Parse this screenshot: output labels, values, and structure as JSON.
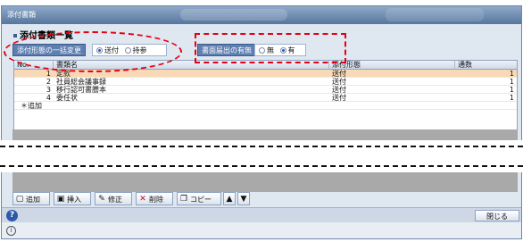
{
  "window": {
    "title": "添付書類"
  },
  "panel": {
    "title": "添付書類一覧"
  },
  "options": {
    "bulk_label": "添付形態の一括変更",
    "bulk_choices": [
      {
        "label": "送付",
        "selected": true
      },
      {
        "label": "持参",
        "selected": false
      }
    ],
    "presence_label": "書面届出の有無",
    "presence_choices": [
      {
        "label": "無",
        "selected": false
      },
      {
        "label": "有",
        "selected": true
      }
    ]
  },
  "grid": {
    "columns": [
      "No.",
      "書類名",
      "添付形態",
      "通数"
    ],
    "rows": [
      {
        "no": "1",
        "name": "定款",
        "form": "送付",
        "count": "1",
        "selected": true
      },
      {
        "no": "2",
        "name": "社員総会議事録",
        "form": "送付",
        "count": "1",
        "selected": false
      },
      {
        "no": "3",
        "name": "移行認可書謄本",
        "form": "送付",
        "count": "1",
        "selected": false
      },
      {
        "no": "4",
        "name": "委任状",
        "form": "送付",
        "count": "1",
        "selected": false
      }
    ],
    "add_row": "＊追加"
  },
  "toolbar": {
    "add": "追加",
    "insert": "挿入",
    "edit": "修正",
    "delete": "削除",
    "copy": "コピー"
  },
  "footer": {
    "close": "閉じる"
  },
  "colors": {
    "annotation": "#e60012",
    "selected_row": "#f9d9b5"
  },
  "icons": [
    "help-icon",
    "info-icon",
    "add-icon",
    "insert-icon",
    "edit-icon",
    "delete-icon",
    "copy-icon",
    "arrow-up-icon",
    "arrow-down-icon"
  ]
}
